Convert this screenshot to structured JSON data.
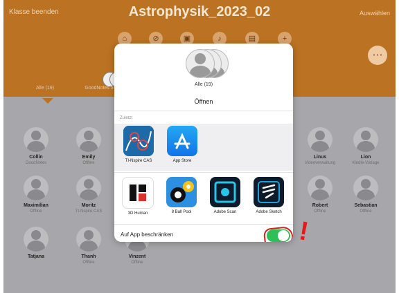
{
  "window": {
    "title": "Astrophysik_2023_02",
    "left_action": "Klasse beenden",
    "right_action": "Auswählen"
  },
  "toolbar": {
    "icons": [
      "navigate-icon",
      "no-icon",
      "lock-icon",
      "mute-icon",
      "presentation-icon",
      "plus-icon"
    ],
    "more_icon": "ellipsis-icon"
  },
  "groups": [
    {
      "label": "Alle (19)"
    },
    {
      "label": "GoodNotes 5"
    }
  ],
  "students": [
    {
      "name": "Collin",
      "status": "GoodNotes"
    },
    {
      "name": "Emily",
      "status": "Offline"
    },
    {
      "name": "Maximilian",
      "status": "Offline"
    },
    {
      "name": "Moritz",
      "status": "TI-Nspire CAS"
    },
    {
      "name": "Tatjana",
      "status": ""
    },
    {
      "name": "Thanh",
      "status": "Offline"
    },
    {
      "name": "Vinzent",
      "status": "Offline"
    },
    {
      "name": "Linus",
      "status": "Videoverwaltung"
    },
    {
      "name": "Lion",
      "status": "Kindle-Vorlage"
    },
    {
      "name": "Robert",
      "status": "Offline"
    },
    {
      "name": "Sebastian",
      "status": "Offline"
    }
  ],
  "sheet": {
    "count_label": "Alle (19)",
    "action_label": "Öffnen",
    "recent_header": "Zuletzt",
    "recent_apps": [
      {
        "label": "TI-Nspire CAS"
      },
      {
        "label": "App Store"
      }
    ],
    "apps": [
      {
        "label": "3D Human"
      },
      {
        "label": "8 Ball Pool"
      },
      {
        "label": "Adobe Scan"
      },
      {
        "label": "Adobe Sketch"
      }
    ],
    "restrict_label": "Auf App beschränken",
    "restrict_enabled": true
  },
  "colors": {
    "header_orange": "#bb7222",
    "toggle_green": "#2fbf57",
    "annotation_red": "#e11b1b"
  }
}
